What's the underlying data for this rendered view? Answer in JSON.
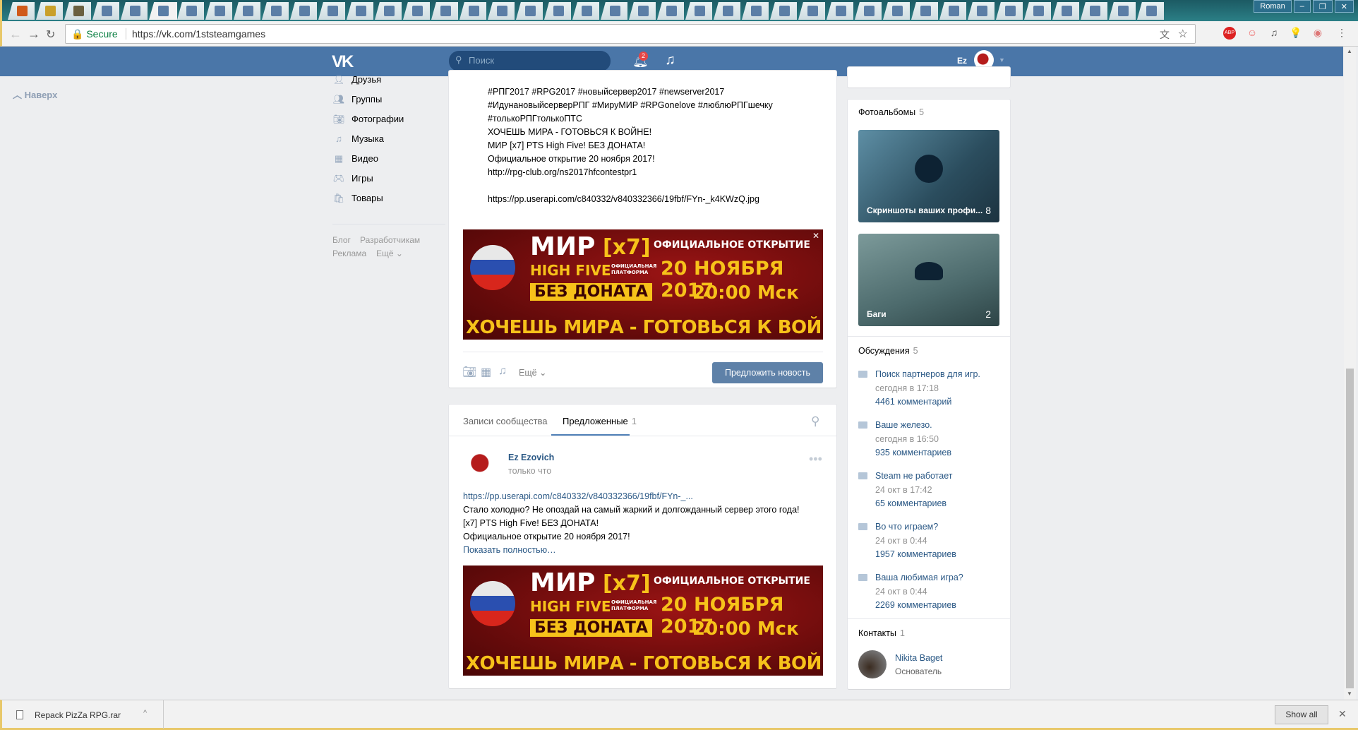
{
  "browser": {
    "tab_count": 41,
    "active_tab_index": 5,
    "user": "Roman",
    "secure_label": "Secure",
    "url": "https://vk.com/1ststeamgames"
  },
  "header": {
    "logo": "VK",
    "search_placeholder": "Поиск",
    "notifications": "2",
    "user_short": "Ez"
  },
  "left": {
    "up_label": "Наверх",
    "nav": [
      {
        "label": "Друзья",
        "icon": "person-icon"
      },
      {
        "label": "Группы",
        "icon": "group-icon"
      },
      {
        "label": "Фотографии",
        "icon": "camera-icon"
      },
      {
        "label": "Музыка",
        "icon": "music-icon"
      },
      {
        "label": "Видео",
        "icon": "film-icon"
      },
      {
        "label": "Игры",
        "icon": "gamepad-icon"
      },
      {
        "label": "Товары",
        "icon": "bag-icon"
      }
    ],
    "footer": {
      "blog": "Блог",
      "dev": "Разработчикам",
      "ads": "Реклама",
      "more": "Ещё"
    }
  },
  "post1": {
    "lines": [
      "#РПГ2017 #RPG2017 #новыйсервер2017 #newserver2017",
      "#ИдунановыйсерверРПГ #МируМИР #RPGonelove #люблюРПГшечку",
      "#толькоРПГтолькоПТС",
      "ХОЧЕШЬ МИРА - ГОТОВЬСЯ К ВОЙНЕ!",
      "МИР [x7] PTS High Five! БЕЗ ДОНАТА!",
      "Официальное открытие 20 ноября 2017!",
      "http://rpg-club.org/ns2017hfcontestpr1",
      "",
      "https://pp.userapi.com/c840332/v840332366/19fbf/FYn-_k4KWzQ.jpg"
    ],
    "more_label": "Ещё",
    "suggest_button": "Предложить новость"
  },
  "banner": {
    "mir": "МИР",
    "x7": "[x7]",
    "high_five": "HIGH FIVE",
    "platform": "ОФИЦИАЛЬНАЯ ПЛАТФОРМА",
    "no_donate": "БЕЗ ДОНАТА",
    "official_open": "ОФИЦИАЛЬНОЕ ОТКРЫТИЕ",
    "date": "20 НОЯБРЯ 2017",
    "time": "20:00 Мск",
    "slogan": "ХОЧЕШЬ МИРА - ГОТОВЬСЯ К ВОЙНЕ"
  },
  "wall": {
    "tab_community": "Записи сообщества",
    "tab_suggested": "Предложенные",
    "suggested_count": "1",
    "post": {
      "author": "Ez Ezovich",
      "time": "только что",
      "link": "https://pp.userapi.com/c840332/v840332366/19fbf/FYn-_...",
      "lines": [
        "Стало холодно? Не опоздай на самый жаркий и долгожданный сервер этого года!",
        "[x7] PTS High Five! БЕЗ ДОНАТА!",
        "Официальное открытие 20 ноября 2017!"
      ],
      "show_more": "Показать полностью…"
    }
  },
  "right": {
    "albums_title": "Фотоальбомы",
    "albums_count": "5",
    "albums": [
      {
        "title": "Скриншоты ваших профи...",
        "count": "8"
      },
      {
        "title": "Баги",
        "count": "2"
      }
    ],
    "discussions_title": "Обсуждения",
    "discussions_count": "5",
    "discussions": [
      {
        "title": "Поиск партнеров для игр.",
        "date": "сегодня в 17:18",
        "comments": "4461 комментарий"
      },
      {
        "title": "Ваше железо.",
        "date": "сегодня в 16:50",
        "comments": "935 комментариев"
      },
      {
        "title": "Steam не работает",
        "date": "24 окт в 17:42",
        "comments": "65 комментариев"
      },
      {
        "title": "Во что играем?",
        "date": "24 окт в 0:44",
        "comments": "1957 комментариев"
      },
      {
        "title": "Ваша любимая игра?",
        "date": "24 окт в 0:44",
        "comments": "2269 комментариев"
      }
    ],
    "contacts_title": "Контакты",
    "contacts_count": "1",
    "contact": {
      "name": "Nikita Baget",
      "role": "Основатель"
    }
  },
  "downloads": {
    "file": "Repack PizZa RPG.rar",
    "show_all": "Show all"
  }
}
